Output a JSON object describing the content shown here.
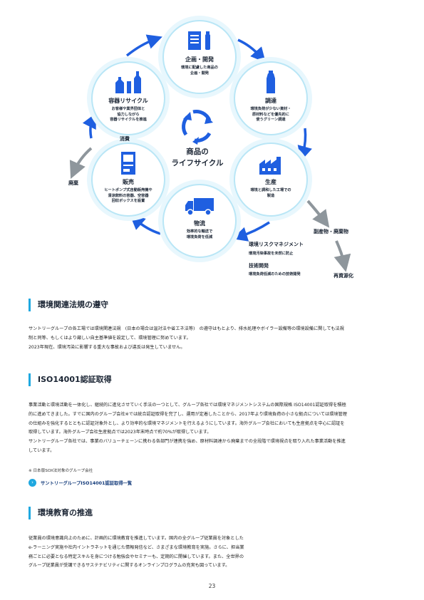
{
  "lifecycle": {
    "center_title": "商品の\nライフサイクル",
    "nodes": {
      "planning": {
        "title": "企画・開発",
        "desc": "環境に配慮した商品の\n企画・開発",
        "icon": "document-and-bottle-icon"
      },
      "procurement": {
        "title": "調達",
        "desc": "環境負荷が少ない資材・\n原材料などを優先的に\n使うグリーン調達",
        "icon": "bottle-icon"
      },
      "production": {
        "title": "生産",
        "desc": "環境と調和した工場での\n製造",
        "icon": "factory-icon"
      },
      "logistics": {
        "title": "物流",
        "desc": "効率的な輸送で\n環境負荷を低減",
        "icon": "truck-icon"
      },
      "sales": {
        "title": "販売",
        "desc": "ヒートポンプ式自動販売機や\n清涼飲料の容器、空容器\n回収ボックスを設置",
        "icon": "vending-machine-icon"
      },
      "recycling": {
        "title": "容器リサイクル",
        "desc": "お客様や業界団体と\n協力しながら\n容器リサイクルを推進",
        "icon": "bottles-icon"
      }
    },
    "labels": {
      "consumption": "消費",
      "disposal": "廃棄",
      "byproduct": "副産物・廃棄物",
      "recycling_resources": "再資源化",
      "risk_title": "環境リスクマネジメント",
      "risk_desc": "環境汚染事故を未然に防止",
      "tech_title": "技術開発",
      "tech_desc": "環境負荷低減のための技術開発"
    },
    "colors": {
      "arrow": "#1f5fe0",
      "gray_arrow": "#8e969c",
      "ring": "#b9e6f6",
      "icon": "#1f5fe0"
    }
  },
  "sections": {
    "laws": {
      "heading": "環境関連法規の遵守",
      "p1": "サントリーグループの各工場では環境関連法規　(日本の場合は温対法や省エネ法等)　の遵守はもとより、排水処理やボイラー設備等の環境設備に関しても法規",
      "p2": "制と同等、もしくはより厳しい自主基準値を設定して、環境管理に努めています。",
      "p3": "2023年現在、環境汚染に影響する重大な事故および違反は発生していません。"
    },
    "iso": {
      "heading": "ISO14001認証取得",
      "p1": "事業活動と環境活動を一体化し、継続的に進化させていく手法の一つとして、グループ各社では環境マネジメントシステムの国際規格 ISO14001認証取得を積極",
      "p2": "的に進めてきました。すでに国内のグループ会社※では統合認証取得を完了し、運用が定着したことから、2017年より環境負荷の小さな拠点については環境管理",
      "p3": "の仕組みを強化するとともに認証対象外とし、より効率的な環境マネジメントを行えるようにしています。海外グループ会社においても生産拠点を中心に認証を",
      "p4": "取得しています。海外グループ会社生産拠点では2023年末時点で約70%が取得しています。",
      "p5": "サントリーグループ各社では、事業のバリューチェーンに携わる各部門が連携を強め、原材料調達から廃棄までの全段階で環境視点を取り入れた事業活動を推進",
      "p6": "しています。",
      "note": "※ 日本版SOX法対象のグループ会社",
      "link": "サントリーグループISO14001認証取得一覧"
    },
    "education": {
      "heading": "環境教育の推進",
      "p1": "従業員の環境意識向上のために、計画的に環境教育を推進しています。国内の全グループ従業員を対象とした",
      "p2": "e-ラーニング実施や社内イントラネットを通じた情報発信など、さまざまな環境教育を実施。さらに、担当業",
      "p3": "務ごとに必要となる特定スキルを身につける勉強会やセミナーも、定期的に開催しています。また、全世界の",
      "p4": "グループ従業員が受講できるサステナビリティに関するオンラインプログラムの充実も図っています。"
    }
  },
  "page_number": "23"
}
